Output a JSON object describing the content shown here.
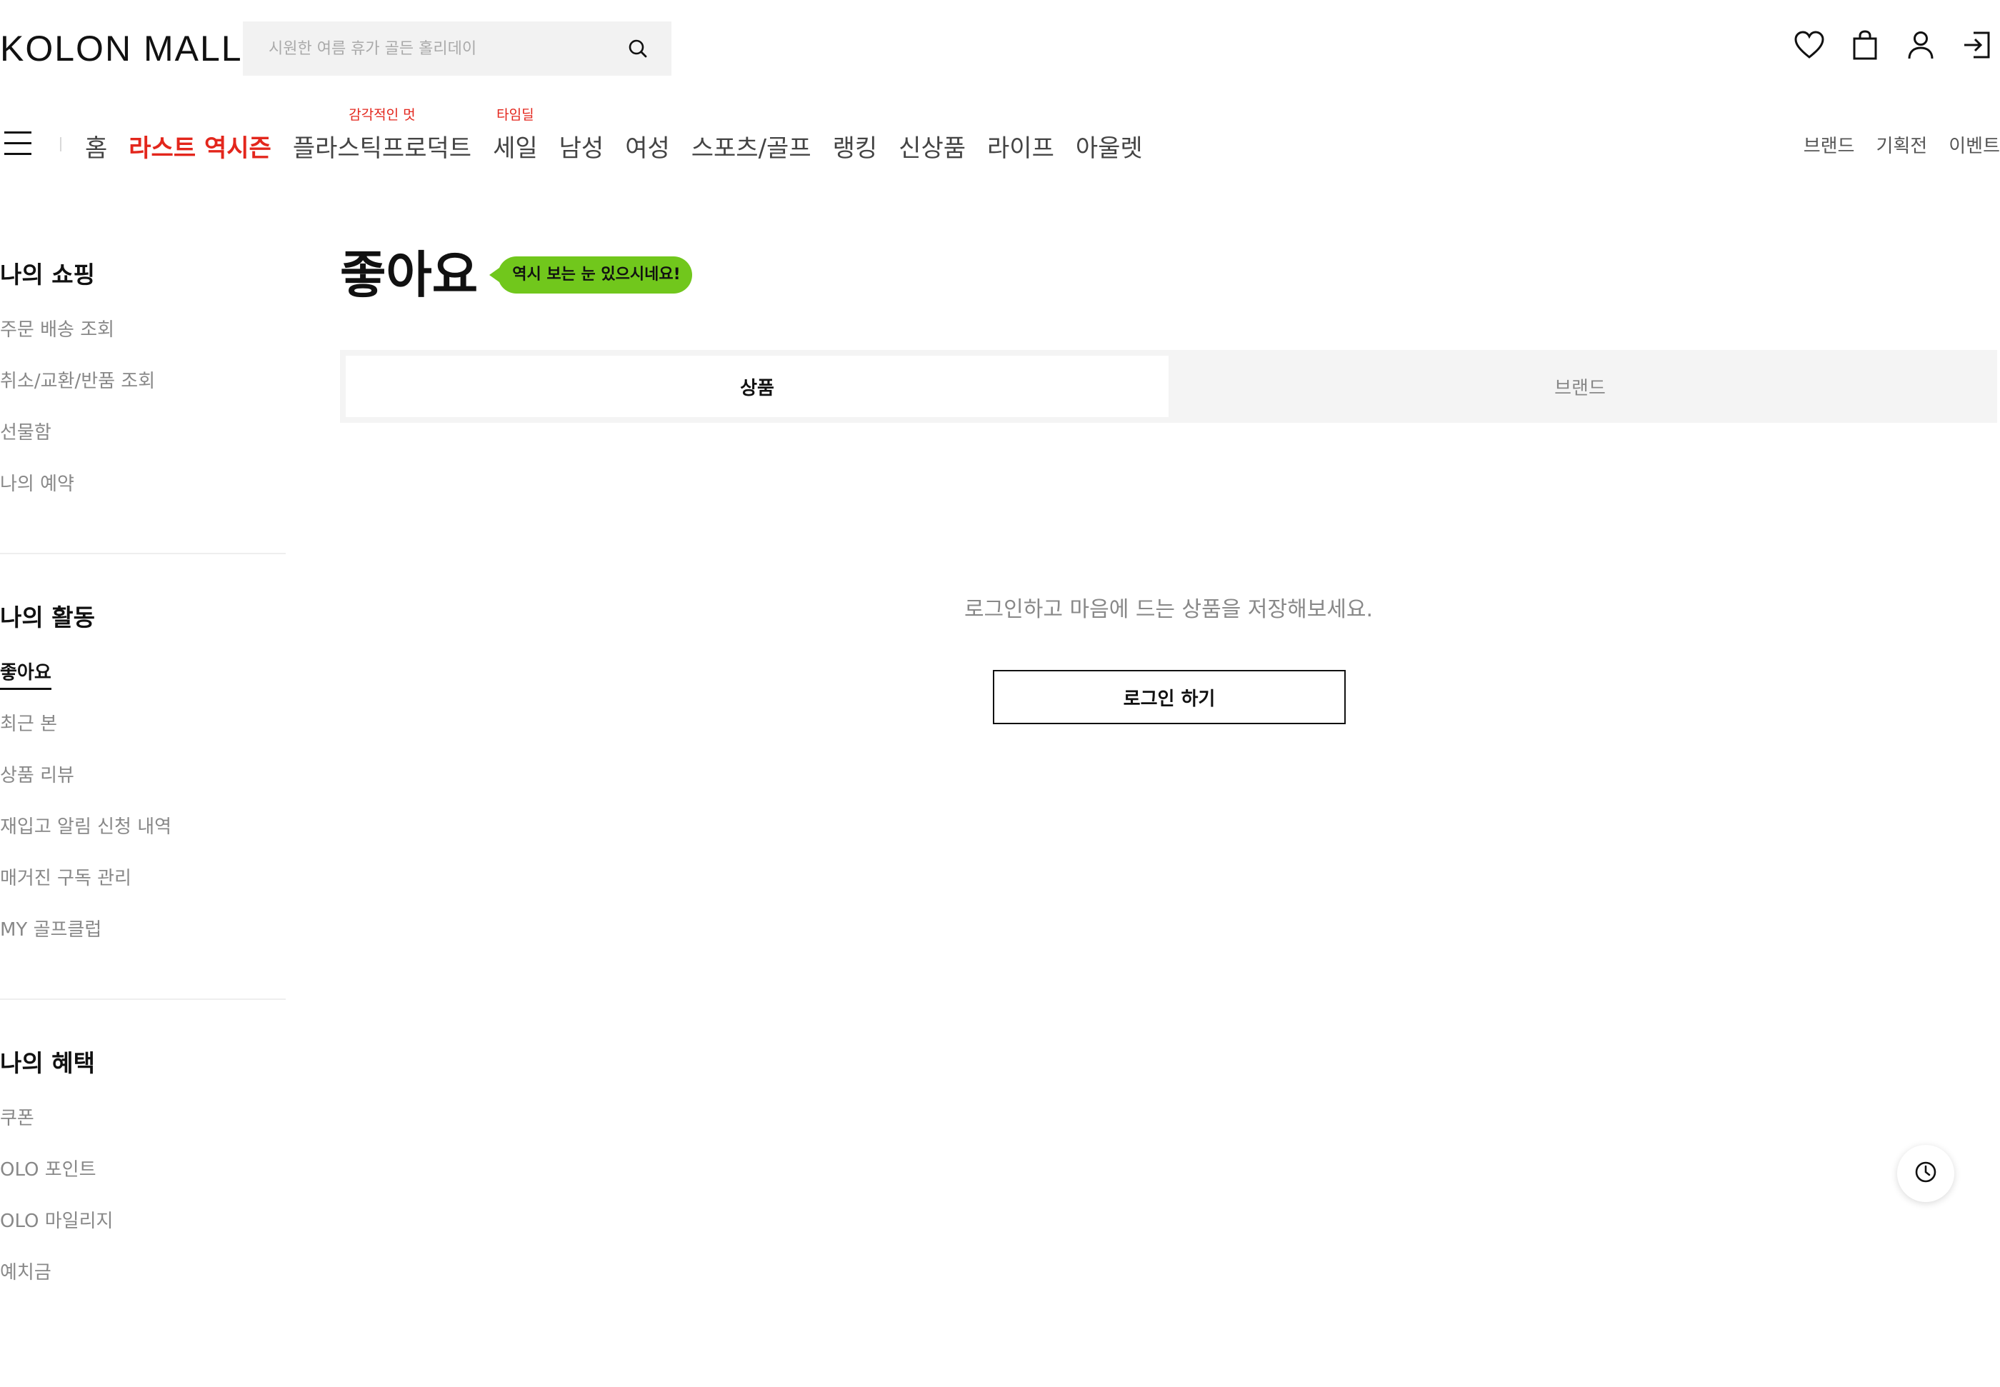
{
  "header": {
    "logo": "KOLON MALL",
    "search_placeholder": "시원한 여름 휴가 골든 홀리데이",
    "icons": [
      "heart-icon",
      "shopping-bag-icon",
      "user-icon",
      "login-icon"
    ]
  },
  "gnb": {
    "items": [
      {
        "label": "홈",
        "tag": ""
      },
      {
        "label": "라스트 역시즌",
        "tag": "",
        "active": true
      },
      {
        "label": "플라스틱프로덕트",
        "tag": "감각적인 멋"
      },
      {
        "label": "세일",
        "tag": "타임딜"
      },
      {
        "label": "남성",
        "tag": ""
      },
      {
        "label": "여성",
        "tag": ""
      },
      {
        "label": "스포츠/골프",
        "tag": ""
      },
      {
        "label": "랭킹",
        "tag": ""
      },
      {
        "label": "신상품",
        "tag": ""
      },
      {
        "label": "라이프",
        "tag": ""
      },
      {
        "label": "아울렛",
        "tag": ""
      }
    ],
    "right_links": [
      "브랜드",
      "기획전",
      "이벤트"
    ]
  },
  "sidebar": {
    "sections": [
      {
        "title": "나의 쇼핑",
        "items": [
          "주문 배송 조회",
          "취소/교환/반품 조회",
          "선물함",
          "나의 예약"
        ]
      },
      {
        "title": "나의 활동",
        "items": [
          "좋아요",
          "최근 본",
          "상품 리뷰",
          "재입고 알림 신청 내역",
          "매거진 구독 관리",
          "MY 골프클럽"
        ]
      },
      {
        "title": "나의 혜택",
        "items": [
          "쿠폰",
          "OLO 포인트",
          "OLO 마일리지",
          "예치금"
        ]
      }
    ],
    "active_item": "좋아요"
  },
  "main": {
    "title": "좋아요",
    "bubble": "역시 보는 눈 있으시네요!",
    "tabs": [
      "상품",
      "브랜드"
    ],
    "active_tab": "상품",
    "empty_message": "로그인하고 마음에 드는 상품을 저장해보세요.",
    "login_button": "로그인 하기"
  },
  "colors": {
    "accent_red": "#e3261c",
    "bubble_green": "#71c71c"
  }
}
